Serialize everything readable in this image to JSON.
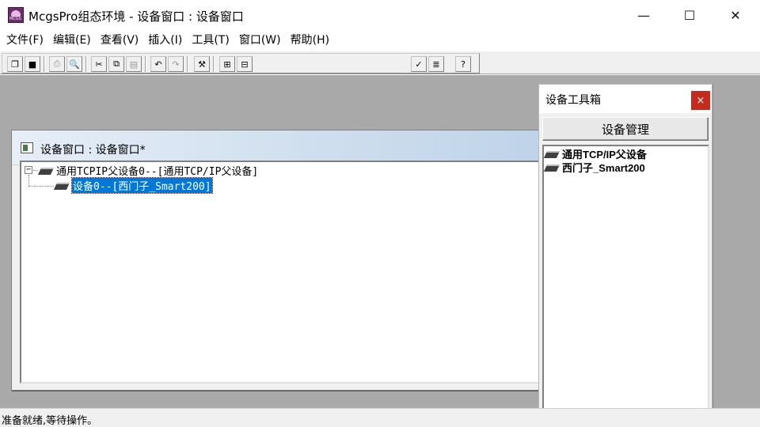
{
  "window": {
    "title": "McgsPro组态环境 - 设备窗口 : 设备窗口",
    "minimize_glyph": "—",
    "maximize_glyph": "☐",
    "close_glyph": "✕"
  },
  "menu": {
    "items": [
      "文件(F)",
      "编辑(E)",
      "查看(V)",
      "插入(I)",
      "工具(T)",
      "窗口(W)",
      "帮助(H)"
    ]
  },
  "toolbar": {
    "buttons": [
      {
        "icon": "new-window-icon",
        "glyph": "❐"
      },
      {
        "icon": "save-icon",
        "glyph": "■"
      },
      {
        "icon": "print-icon",
        "glyph": "⎙"
      },
      {
        "icon": "print-preview-icon",
        "glyph": "🔍"
      },
      {
        "icon": "cut-icon",
        "glyph": "✂"
      },
      {
        "icon": "copy-icon",
        "glyph": "⧉"
      },
      {
        "icon": "paste-icon",
        "glyph": "▤"
      },
      {
        "icon": "undo-icon",
        "glyph": "↶"
      },
      {
        "icon": "redo-icon",
        "glyph": "↷"
      },
      {
        "icon": "tools-icon",
        "glyph": "⚒"
      },
      {
        "icon": "device-tree-icon",
        "glyph": "⊞"
      },
      {
        "icon": "device-config-icon",
        "glyph": "⊟"
      },
      {
        "icon": "check-icon",
        "glyph": "✓"
      },
      {
        "icon": "list-icon",
        "glyph": "≣"
      },
      {
        "icon": "help-icon",
        "glyph": "?"
      }
    ]
  },
  "device_window": {
    "title": "设备窗口 : 设备窗口*",
    "tree": [
      {
        "toggle": "−",
        "label": "通用TCPIP父设备0--[通用TCP/IP父设备]"
      },
      {
        "label": "设备0--[西门子_Smart200]",
        "selected": true
      }
    ]
  },
  "toolbox": {
    "title": "设备工具箱",
    "close_glyph": "×",
    "manage_button": "设备管理",
    "items": [
      "通用TCP/IP父设备",
      "西门子_Smart200"
    ]
  },
  "status": {
    "text": "准备就绪,等待操作。"
  }
}
